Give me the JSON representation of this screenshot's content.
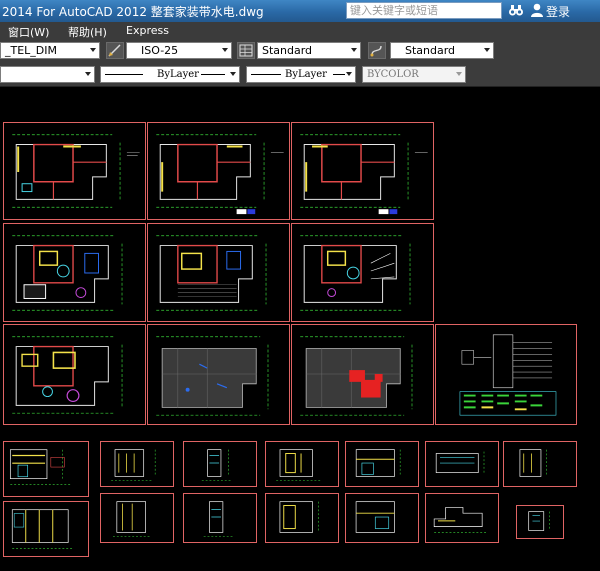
{
  "titlebar": {
    "title": "2014  For AutoCAD 2012    整套家装带水电.dwg",
    "search_placeholder": "键入关键字或短语",
    "login_label": "登录"
  },
  "menubar": {
    "items": [
      "窗口(W)",
      "帮助(H)",
      "Express"
    ]
  },
  "toolbar1": {
    "text_style": "_TEL_DIM",
    "dim_style": "ISO-25",
    "table_style": "Standard",
    "multileader_style": "Standard"
  },
  "toolbar2": {
    "color": "",
    "linetype": "ByLayer",
    "lineweight": "ByLayer",
    "plot_style": "BYCOLOR"
  },
  "colors": {
    "background": "#000000",
    "sheet_border": "#e06464",
    "titlebar": "#2a69a6",
    "toolbar": "#3c3c3c"
  }
}
